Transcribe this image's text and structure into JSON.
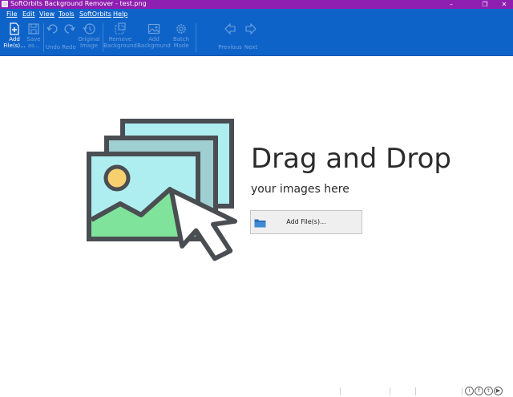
{
  "window": {
    "title": "SoftOrbits Background Remover - test.png"
  },
  "menu": [
    {
      "label": "File"
    },
    {
      "label": "Edit"
    },
    {
      "label": "View"
    },
    {
      "label": "Tools"
    },
    {
      "label": "SoftOrbits"
    },
    {
      "label": "Help"
    }
  ],
  "toolbar": {
    "add_files": {
      "line1": "Add",
      "line2": "File(s)..."
    },
    "save_as": {
      "line1": "Save",
      "line2": "as..."
    },
    "undo": {
      "line1": "Undo"
    },
    "redo": {
      "line1": "Redo"
    },
    "original_image": {
      "line1": "Original",
      "line2": "Image"
    },
    "remove_background": {
      "line1": "Remove",
      "line2": "Background"
    },
    "add_background": {
      "line1": "Add",
      "line2": "Background"
    },
    "batch_mode": {
      "line1": "Batch",
      "line2": "Mode"
    },
    "previous": {
      "line1": "Previous"
    },
    "next": {
      "line1": "Next"
    }
  },
  "main": {
    "title": "Drag and Drop",
    "subtitle": "your images here",
    "add_button_label": "Add File(s)..."
  },
  "colors": {
    "titlebar": "#8f1fb0",
    "ribbon": "#0e63c9",
    "illustration_outline": "#4a4e52",
    "illustration_sky": "#aeeef0",
    "illustration_mid": "#9fcfd1",
    "illustration_hill": "#7fe39b",
    "illustration_sun": "#f8cf6e"
  }
}
